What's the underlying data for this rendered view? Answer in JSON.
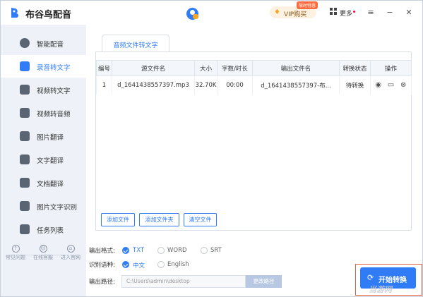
{
  "app": {
    "name": "布谷鸟配音"
  },
  "header": {
    "vip_label": "VIP购买",
    "vip_badge": "限时特惠",
    "more_label": "更多"
  },
  "sidebar": {
    "items": [
      {
        "label": "智能配音",
        "icon": "voice-icon"
      },
      {
        "label": "录音转文字",
        "icon": "record-icon",
        "active": true
      },
      {
        "label": "视频转文字",
        "icon": "video-icon"
      },
      {
        "label": "视频转音频",
        "icon": "video-audio-icon"
      },
      {
        "label": "图片翻译",
        "icon": "image-icon"
      },
      {
        "label": "文字翻译",
        "icon": "text-icon"
      },
      {
        "label": "文档翻译",
        "icon": "document-icon"
      },
      {
        "label": "图片文字识别",
        "icon": "ocr-icon"
      },
      {
        "label": "任务列表",
        "icon": "tasks-icon"
      }
    ],
    "bottom": [
      {
        "label": "常见问题",
        "icon": "question-icon"
      },
      {
        "label": "在线客服",
        "icon": "support-icon"
      },
      {
        "label": "进入官网",
        "icon": "website-icon"
      }
    ]
  },
  "main": {
    "tab_label": "音频文件转文字",
    "table": {
      "headers": [
        "编号",
        "源文件名",
        "大小",
        "字数/时长",
        "输出文件名",
        "转换状态",
        "操作"
      ],
      "rows": [
        {
          "no": "1",
          "source": "d_1641438557397.mp3",
          "size": "32.70K",
          "duration": "00:00",
          "output": "d_1641438557397-布...",
          "status": "待转换"
        }
      ]
    },
    "buttons": {
      "add_file": "添加文件",
      "add_folder": "添加文件夹",
      "clear_files": "清空文件"
    }
  },
  "options": {
    "format_label": "输出格式:",
    "formats": [
      {
        "label": "TXT",
        "checked": true
      },
      {
        "label": "WORD",
        "checked": false
      },
      {
        "label": "SRT",
        "checked": false
      }
    ],
    "language_label": "识别语种:",
    "languages": [
      {
        "label": "中文",
        "checked": true
      },
      {
        "label": "English",
        "checked": false
      }
    ],
    "path_label": "输出路径:",
    "path_value": "C:\\Users\\admin\\desktop",
    "change_path": "更改路径"
  },
  "start_button": "开始转换",
  "watermark": "当游网",
  "colors": {
    "accent": "#2f7cf6",
    "sidebar_bg": "#eef2f8",
    "highlight": "#e85a3c"
  }
}
